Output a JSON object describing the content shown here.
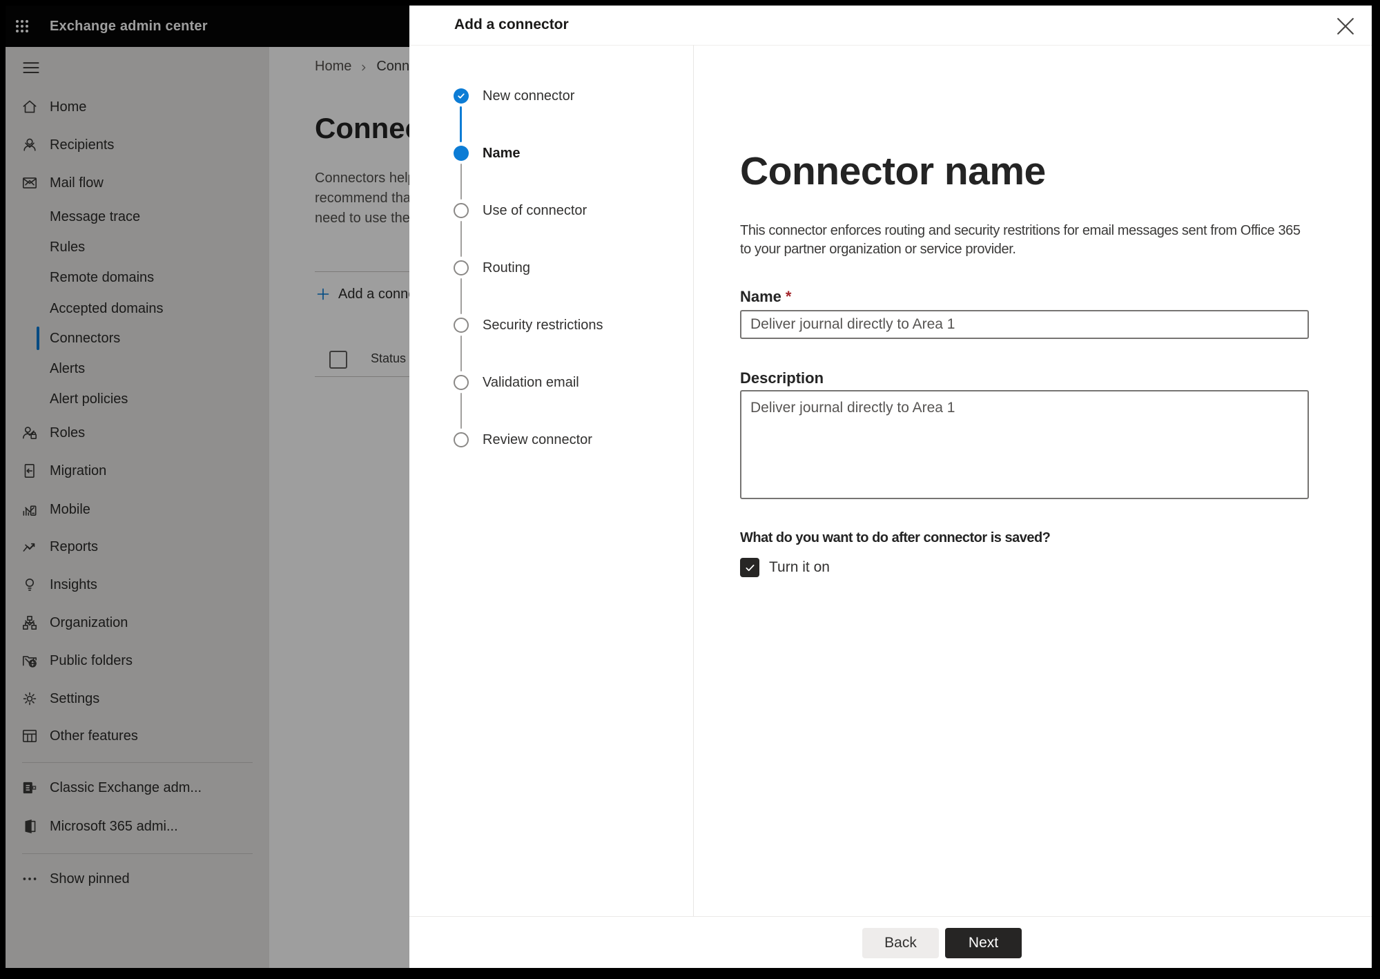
{
  "topbar": {
    "title": "Exchange admin center"
  },
  "sidebar": {
    "items": [
      {
        "kind": "burger",
        "icon": "hamburger-icon",
        "label": ""
      },
      {
        "kind": "item",
        "icon": "home-icon",
        "label": "Home"
      },
      {
        "kind": "item",
        "icon": "person-icon",
        "label": "Recipients",
        "chevron": "down"
      },
      {
        "kind": "item",
        "icon": "mail-icon",
        "label": "Mail flow",
        "chevron": "up"
      },
      {
        "kind": "sub",
        "label": "Message trace"
      },
      {
        "kind": "sub",
        "label": "Rules"
      },
      {
        "kind": "sub",
        "label": "Remote domains"
      },
      {
        "kind": "sub",
        "label": "Accepted domains"
      },
      {
        "kind": "sub",
        "label": "Connectors",
        "selected": true
      },
      {
        "kind": "sub",
        "label": "Alerts"
      },
      {
        "kind": "sub",
        "label": "Alert policies"
      },
      {
        "kind": "item",
        "icon": "roles-icon",
        "label": "Roles",
        "chevron": "down"
      },
      {
        "kind": "item",
        "icon": "migration-icon",
        "label": "Migration"
      },
      {
        "kind": "item",
        "icon": "mobile-icon",
        "label": "Mobile",
        "chevron": "down"
      },
      {
        "kind": "item",
        "icon": "reports-icon",
        "label": "Reports",
        "chevron": "down"
      },
      {
        "kind": "item",
        "icon": "insights-icon",
        "label": "Insights"
      },
      {
        "kind": "item",
        "icon": "organization-icon",
        "label": "Organization",
        "chevron": "down"
      },
      {
        "kind": "item",
        "icon": "public-folders-icon",
        "label": "Public folders",
        "chevron": "down"
      },
      {
        "kind": "item",
        "icon": "settings-icon",
        "label": "Settings"
      },
      {
        "kind": "item",
        "icon": "other-features-icon",
        "label": "Other features"
      },
      {
        "kind": "divider"
      },
      {
        "kind": "item",
        "icon": "classic-exchange-icon",
        "label": "Classic Exchange adm..."
      },
      {
        "kind": "item",
        "icon": "m365-icon",
        "label": "Microsoft 365 admi..."
      },
      {
        "kind": "divider"
      },
      {
        "kind": "item",
        "icon": "ellipsis-icon",
        "label": "Show pinned"
      }
    ]
  },
  "page": {
    "breadcrumb": {
      "home": "Home",
      "current": "Connectors"
    },
    "title": "Connectors",
    "intro_lines": [
      "Connectors help",
      "recommend that",
      "need to use them"
    ],
    "add_button_label": "Add a connector",
    "table": {
      "select_all_checked": false,
      "status_column": "Status"
    }
  },
  "dialog": {
    "title": "Add a connector",
    "steps": [
      {
        "label": "New connector",
        "state": "completed"
      },
      {
        "label": "Name",
        "state": "current"
      },
      {
        "label": "Use of connector",
        "state": "upcoming"
      },
      {
        "label": "Routing",
        "state": "upcoming"
      },
      {
        "label": "Security restrictions",
        "state": "upcoming"
      },
      {
        "label": "Validation email",
        "state": "upcoming"
      },
      {
        "label": "Review connector",
        "state": "upcoming"
      }
    ],
    "content": {
      "heading": "Connector name",
      "description_lines": [
        "This connector enforces routing and security restritions for email messages sent from Office 365",
        "to your partner organization or service provider."
      ],
      "name_label": "Name",
      "required_marker": "*",
      "name_value": "Deliver journal directly to Area 1",
      "description_label": "Description",
      "description_value": "Deliver journal directly to Area 1",
      "after_save_question": "What do you want to do after connector is saved?",
      "turn_on_label": "Turn it on",
      "turn_on_checked": true
    },
    "footer": {
      "back_label": "Back",
      "next_label": "Next"
    }
  },
  "colors": {
    "accent_blue": "#0c7cd5",
    "required_red": "#a4262c",
    "primary_button": "#262524",
    "selected_nav": "#0078d4"
  }
}
